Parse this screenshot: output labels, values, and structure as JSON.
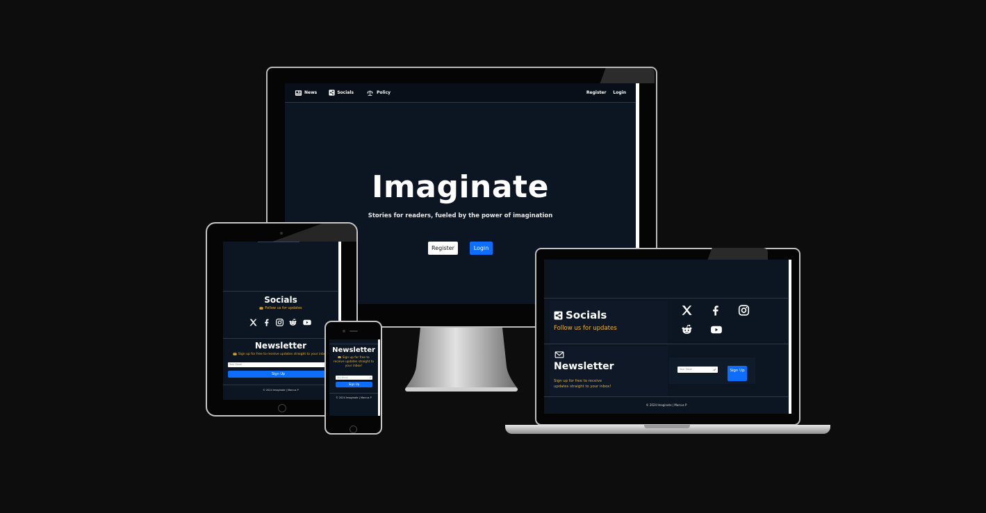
{
  "monitor": {
    "nav": {
      "news": "News",
      "socials": "Socials",
      "policy": "Policy",
      "register": "Register",
      "login": "Login"
    },
    "hero": {
      "title": "Imaginate",
      "subtitle": "Stories for readers, fueled by the power of imagination",
      "register_button": "Register",
      "login_button": "Login"
    }
  },
  "tablet": {
    "socials_heading": "Socials",
    "socials_tagline": "Follow us for updates",
    "social_icons": [
      "x-icon",
      "facebook-icon",
      "instagram-icon",
      "reddit-icon",
      "youtube-icon"
    ],
    "newsletter_heading": "Newsletter",
    "newsletter_tagline": "Sign up for free to receive updates straight to your inbox!",
    "email_placeholder": "Your Email",
    "signup_button": "Sign Up",
    "footer": "© 2024 Imaginate | Marcus P"
  },
  "phone": {
    "newsletter_heading": "Newsletter",
    "newsletter_tagline": "Sign up for free to receive updates straight to your inbox!",
    "email_placeholder": "Your Email",
    "signup_button": "Sign Up",
    "footer": "© 2024 Imaginate | Marcus P"
  },
  "laptop": {
    "socials_heading": "Socials",
    "socials_tagline": "Follow us for updates",
    "social_icons": [
      "x-icon",
      "facebook-icon",
      "instagram-icon",
      "reddit-icon",
      "youtube-icon"
    ],
    "newsletter_heading": "Newsletter",
    "newsletter_tagline": "Sign up for free to receive updates straight to your inbox!",
    "email_placeholder": "Your Email",
    "signup_button": "Sign Up",
    "footer": "© 2024 Imaginate | Marcus P"
  },
  "colors": {
    "background": "#0d0d0d",
    "screen_bg": "#0c1522",
    "accent_blue": "#0d6efd",
    "accent_yellow": "#f0b429"
  }
}
